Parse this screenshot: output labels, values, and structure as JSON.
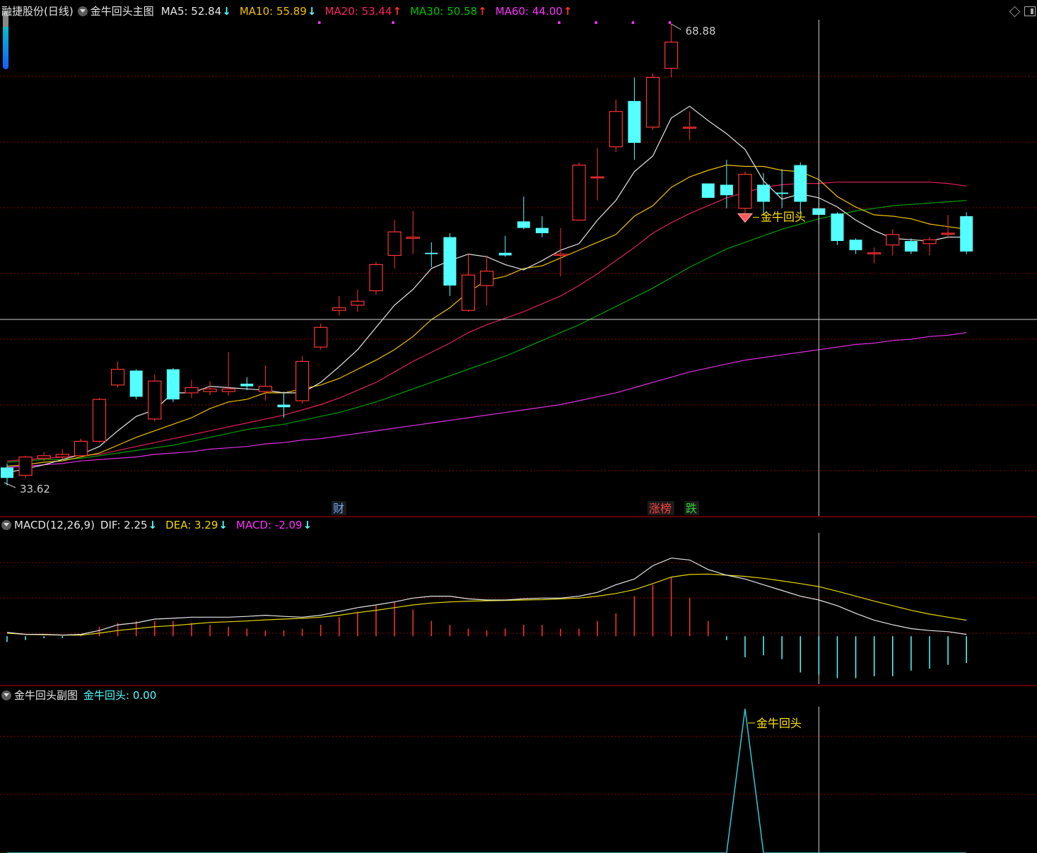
{
  "header": {
    "stock_name": "融捷股份(日线)",
    "main_indicator": "金牛回头主图",
    "ma": [
      {
        "label": "MA5: 52.84",
        "arrow": "↓",
        "color": "#e6e6e6"
      },
      {
        "label": "MA10: 55.89",
        "arrow": "↓",
        "color": "#f0c000"
      },
      {
        "label": "MA20: 53.44",
        "arrow": "↑",
        "color": "#ff2060"
      },
      {
        "label": "MA30: 50.58",
        "arrow": "↑",
        "color": "#00c000"
      },
      {
        "label": "MA60: 44.00",
        "arrow": "↑",
        "color": "#ff30ff"
      }
    ]
  },
  "macd_header": {
    "title": "MACD(12,26,9)",
    "dif": "DIF: 2.25",
    "dif_arrow": "↓",
    "dea": "DEA: 3.29",
    "dea_arrow": "↓",
    "macd": "MACD: -2.09",
    "macd_arrow": "↓"
  },
  "sub_header": {
    "title": "金牛回头副图",
    "value": "金牛回头: 0.00"
  },
  "annotations": {
    "high": "68.88",
    "low": "33.62",
    "signal_main": "金牛回头",
    "signal_sub": "金牛回头",
    "badge_cai": "财",
    "badge_zhangbang": "涨榜",
    "badge_die": "跌"
  },
  "colors": {
    "bg": "#000000",
    "up": "#ff3232",
    "down": "#54ffff",
    "grid": "#8a0000",
    "ma5": "#e6e6e6",
    "ma10": "#f0c000",
    "ma20": "#e0205a",
    "ma30": "#00a000",
    "ma60": "#e030e0",
    "dif": "#e6e6e6",
    "dea": "#e6d800",
    "signal": "#ffe000"
  },
  "chart_data": {
    "type": "candlestick",
    "price_range": [
      33.62,
      68.88
    ],
    "crosshair_index": 44,
    "candles": [
      [
        35.0,
        34.2,
        35.3,
        33.62
      ],
      [
        34.4,
        35.8,
        35.9,
        34.2
      ],
      [
        35.7,
        35.9,
        36.2,
        35.5
      ],
      [
        35.8,
        36.0,
        36.4,
        35.6
      ],
      [
        35.9,
        37.0,
        37.2,
        35.9
      ],
      [
        37.0,
        40.2,
        40.3,
        36.9
      ],
      [
        41.3,
        42.5,
        43.1,
        41.1
      ],
      [
        42.4,
        40.4,
        42.5,
        40.2
      ],
      [
        38.7,
        41.6,
        42.1,
        38.5
      ],
      [
        42.5,
        40.2,
        42.6,
        40.0
      ],
      [
        40.7,
        41.1,
        41.7,
        40.3
      ],
      [
        40.8,
        41.0,
        41.6,
        40.5
      ],
      [
        40.8,
        41.0,
        43.8,
        40.5
      ],
      [
        41.4,
        41.2,
        41.9,
        40.9
      ],
      [
        40.8,
        41.2,
        42.8,
        40.1
      ],
      [
        39.8,
        39.6,
        40.8,
        38.8
      ],
      [
        40.1,
        43.1,
        43.5,
        39.9
      ],
      [
        44.2,
        45.7,
        46.0,
        44.0
      ],
      [
        47.0,
        47.2,
        48.1,
        46.6
      ],
      [
        47.4,
        47.7,
        48.6,
        46.9
      ],
      [
        48.5,
        50.5,
        50.7,
        48.2
      ],
      [
        51.2,
        53.0,
        53.9,
        50.2
      ],
      [
        52.5,
        52.6,
        54.6,
        51.3
      ],
      [
        51.4,
        51.3,
        52.2,
        50.3
      ],
      [
        52.6,
        48.9,
        52.9,
        48.1
      ],
      [
        47.0,
        49.7,
        51.3,
        46.9
      ],
      [
        48.9,
        50.0,
        51.2,
        47.4
      ],
      [
        51.4,
        51.2,
        52.7,
        51.1
      ],
      [
        53.8,
        53.3,
        55.7,
        53.2
      ],
      [
        53.3,
        52.9,
        54.2,
        52.6
      ],
      [
        51.2,
        51.3,
        53.3,
        49.6
      ],
      [
        53.9,
        58.1,
        58.3,
        54.4
      ],
      [
        57.2,
        57.2,
        59.4,
        55.4
      ],
      [
        59.5,
        62.2,
        63.1,
        59.1
      ],
      [
        63.0,
        59.8,
        64.8,
        58.5
      ],
      [
        61.0,
        64.8,
        65.1,
        60.8
      ],
      [
        65.5,
        67.5,
        68.88,
        64.8
      ],
      [
        61.0,
        61.0,
        62.2,
        60.0
      ],
      [
        56.7,
        55.6,
        56.7,
        55.6
      ],
      [
        56.6,
        55.8,
        58.5,
        54.8
      ],
      [
        54.8,
        57.4,
        57.6,
        53.9
      ],
      [
        56.6,
        55.3,
        57.5,
        54.4
      ],
      [
        56.0,
        55.9,
        57.8,
        54.8
      ],
      [
        58.1,
        55.3,
        58.3,
        54.4
      ],
      [
        54.8,
        54.3,
        55.6,
        53.6
      ],
      [
        54.4,
        52.3,
        54.5,
        52.0
      ],
      [
        52.4,
        51.6,
        52.5,
        51.3
      ],
      [
        51.4,
        51.4,
        51.8,
        50.6
      ],
      [
        52.0,
        52.8,
        53.2,
        51.2
      ],
      [
        52.3,
        51.5,
        52.5,
        51.3
      ],
      [
        52.1,
        52.4,
        52.6,
        51.2
      ],
      [
        52.9,
        52.9,
        54.3,
        52.5
      ],
      [
        54.2,
        51.5,
        54.5,
        51.3
      ]
    ],
    "ma5": [
      34.6,
      34.9,
      35.2,
      35.6,
      36.0,
      36.6,
      37.8,
      38.9,
      39.4,
      40.7,
      40.7,
      41.2,
      41.1,
      41.0,
      40.9,
      40.7,
      40.7,
      41.5,
      42.7,
      44.0,
      45.7,
      47.4,
      48.6,
      50.2,
      50.8,
      51.3,
      51.1,
      50.5,
      50.1,
      50.8,
      51.6,
      52.1,
      53.9,
      55.4,
      57.6,
      58.8,
      61.7,
      62.6,
      61.5,
      60.5,
      59.3,
      56.9,
      55.5,
      55.9,
      55.6,
      54.9,
      53.9,
      53.1,
      52.5,
      52.4,
      52.3,
      52.6,
      52.6
    ],
    "ma10": [
      35.1,
      35.2,
      35.4,
      35.5,
      35.8,
      36.1,
      36.7,
      37.3,
      37.8,
      38.3,
      38.8,
      39.5,
      40.0,
      40.2,
      40.7,
      40.7,
      41.0,
      41.3,
      41.8,
      42.5,
      43.2,
      44.0,
      45.0,
      46.3,
      47.2,
      48.4,
      49.3,
      49.6,
      50.2,
      50.4,
      51.0,
      51.6,
      52.2,
      52.8,
      54.2,
      55.0,
      56.4,
      57.2,
      57.7,
      58.1,
      58.0,
      58.0,
      57.7,
      57.6,
      57.0,
      55.7,
      54.9,
      54.3,
      54.2,
      54.0,
      53.6,
      53.4,
      53.2
    ],
    "ma20": [
      35.5,
      35.6,
      35.7,
      35.8,
      35.9,
      36.0,
      36.3,
      36.6,
      36.9,
      37.2,
      37.5,
      37.8,
      38.1,
      38.4,
      38.7,
      39.0,
      39.4,
      39.8,
      40.3,
      40.9,
      41.5,
      42.3,
      43.1,
      43.8,
      44.5,
      45.3,
      45.9,
      46.4,
      46.9,
      47.5,
      48.1,
      48.9,
      49.8,
      50.8,
      51.8,
      52.9,
      53.7,
      54.4,
      55.0,
      55.6,
      56.0,
      56.4,
      56.6,
      56.7,
      56.7,
      56.8,
      56.8,
      56.8,
      56.8,
      56.8,
      56.8,
      56.7,
      56.5
    ],
    "ma30": [
      35.4,
      35.5,
      35.6,
      35.6,
      35.7,
      35.9,
      36.1,
      36.3,
      36.5,
      36.7,
      37.0,
      37.3,
      37.6,
      37.9,
      38.1,
      38.3,
      38.6,
      38.9,
      39.2,
      39.6,
      40.0,
      40.5,
      41.0,
      41.5,
      42.0,
      42.5,
      43.0,
      43.5,
      44.1,
      44.7,
      45.3,
      45.9,
      46.6,
      47.3,
      48.0,
      48.7,
      49.5,
      50.3,
      51.0,
      51.7,
      52.2,
      52.7,
      53.2,
      53.6,
      54.0,
      54.3,
      54.6,
      54.8,
      55.0,
      55.1,
      55.2,
      55.3,
      55.4
    ],
    "ma60": [
      35.0,
      35.1,
      35.2,
      35.3,
      35.5,
      35.6,
      35.7,
      35.8,
      36.0,
      36.1,
      36.2,
      36.4,
      36.5,
      36.6,
      36.8,
      36.9,
      37.1,
      37.2,
      37.4,
      37.6,
      37.8,
      38.0,
      38.2,
      38.4,
      38.6,
      38.8,
      39.0,
      39.2,
      39.4,
      39.6,
      39.8,
      40.1,
      40.4,
      40.7,
      41.1,
      41.5,
      41.9,
      42.3,
      42.6,
      42.9,
      43.2,
      43.4,
      43.6,
      43.8,
      44.0,
      44.2,
      44.4,
      44.5,
      44.7,
      44.8,
      45.0,
      45.1,
      45.3
    ],
    "macd_range": [
      -1.2,
      2.6
    ],
    "dif": [
      0.1,
      0.05,
      0.05,
      0.03,
      0.05,
      0.15,
      0.3,
      0.35,
      0.45,
      0.47,
      0.5,
      0.5,
      0.5,
      0.52,
      0.55,
      0.52,
      0.5,
      0.55,
      0.65,
      0.75,
      0.82,
      0.9,
      1.0,
      1.05,
      1.05,
      0.98,
      0.95,
      0.95,
      0.98,
      1.0,
      1.0,
      1.05,
      1.15,
      1.35,
      1.5,
      1.85,
      2.05,
      2.0,
      1.75,
      1.6,
      1.5,
      1.35,
      1.2,
      1.05,
      0.95,
      0.8,
      0.6,
      0.42,
      0.3,
      0.2,
      0.15,
      0.12,
      0.05
    ],
    "dea": [
      0.08,
      0.05,
      0.04,
      0.03,
      0.03,
      0.08,
      0.15,
      0.2,
      0.25,
      0.28,
      0.32,
      0.36,
      0.38,
      0.4,
      0.43,
      0.45,
      0.47,
      0.5,
      0.55,
      0.62,
      0.68,
      0.75,
      0.82,
      0.87,
      0.9,
      0.92,
      0.93,
      0.94,
      0.95,
      0.96,
      0.98,
      1.0,
      1.05,
      1.12,
      1.22,
      1.38,
      1.55,
      1.62,
      1.63,
      1.6,
      1.57,
      1.52,
      1.45,
      1.38,
      1.3,
      1.18,
      1.05,
      0.92,
      0.8,
      0.68,
      0.58,
      0.5,
      0.42
    ],
    "macd": [
      -0.15,
      -0.1,
      -0.05,
      -0.05,
      0.05,
      0.25,
      0.35,
      0.4,
      0.4,
      0.4,
      0.35,
      0.3,
      0.25,
      0.2,
      0.15,
      0.15,
      0.2,
      0.3,
      0.5,
      0.65,
      0.8,
      0.9,
      0.7,
      0.4,
      0.3,
      0.2,
      0.15,
      0.2,
      0.3,
      0.3,
      0.2,
      0.2,
      0.4,
      0.6,
      1.05,
      1.35,
      1.55,
      1.0,
      0.4,
      -0.1,
      -0.55,
      -0.5,
      -0.6,
      -0.95,
      -1.0,
      -1.1,
      -1.1,
      -1.05,
      -1.05,
      -0.9,
      -0.85,
      -0.75,
      -0.7
    ],
    "signal": [
      0,
      0,
      0,
      0,
      0,
      0,
      0,
      0,
      0,
      0,
      0,
      0,
      0,
      0,
      0,
      0,
      0,
      0,
      0,
      0,
      0,
      0,
      0,
      0,
      0,
      0,
      0,
      0,
      0,
      0,
      0,
      0,
      0,
      0,
      0,
      0,
      0,
      0,
      0,
      0,
      1,
      0,
      0,
      0,
      0,
      0,
      0,
      0,
      0,
      0,
      0,
      0,
      0
    ],
    "signal_index": 40
  }
}
